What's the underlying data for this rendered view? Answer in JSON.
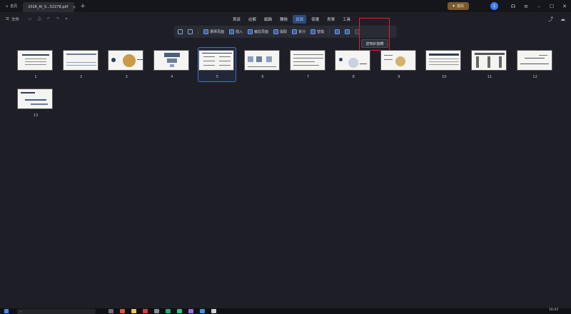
{
  "titlebar": {
    "home_label": "首頁",
    "doc_tab_label": "2026_AI_S...52278.pdf",
    "upgrade_label": "猶買",
    "avatar_initial": "1"
  },
  "menubar": {
    "file_label": "文件",
    "tabs": [
      {
        "label": "首頁",
        "active": false
      },
      {
        "label": "註解",
        "active": false
      },
      {
        "label": "編輯",
        "active": false
      },
      {
        "label": "轉換",
        "active": false
      },
      {
        "label": "頁面",
        "active": true
      },
      {
        "label": "保護",
        "active": false
      },
      {
        "label": "表單",
        "active": false
      },
      {
        "label": "工具",
        "active": false
      }
    ]
  },
  "toolbar": {
    "tools": [
      {
        "label": "",
        "icon": "zoom-out-icon"
      },
      {
        "label": "",
        "icon": "zoom-in-icon"
      },
      {
        "label": "選擇頁面",
        "icon": "select-pages-icon"
      },
      {
        "label": "插入",
        "icon": "insert-icon"
      },
      {
        "label": "裁剪頁面",
        "icon": "crop-page-icon"
      },
      {
        "label": "提取",
        "icon": "extract-icon"
      },
      {
        "label": "拆分",
        "icon": "split-icon"
      },
      {
        "label": "替換",
        "icon": "replace-icon"
      }
    ],
    "rotate_tooltip": "逆時針旋轉"
  },
  "pages": [
    "1",
    "2",
    "3",
    "4",
    "5",
    "6",
    "7",
    "8",
    "9",
    "10",
    "11",
    "12",
    "13"
  ],
  "selected_page": "5",
  "taskbar": {
    "clock": "16:43"
  }
}
